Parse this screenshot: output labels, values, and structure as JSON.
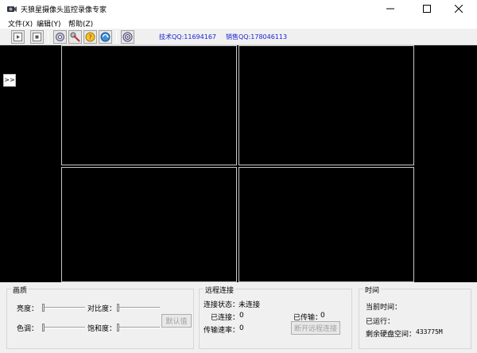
{
  "window": {
    "title": "天狼星摄像头监控录像专家"
  },
  "menu": [
    "文件(X)",
    "编辑(Y)",
    "帮助(Z)"
  ],
  "toolbar": {
    "buttons": [
      "play-icon",
      "stop-icon",
      "settings-icon",
      "search-camera-icon",
      "help-icon",
      "refresh-icon",
      "about-icon"
    ],
    "tech_qq": "技术QQ:11694167",
    "sales_qq": "销售QQ:178046113"
  },
  "video": {
    "expand_label": ">>"
  },
  "image_quality": {
    "title": "画质",
    "brightness_label": "亮度：",
    "contrast_label": "对比度：",
    "hue_label": "色调：",
    "saturation_label": "饱和度：",
    "default_button": "默认值"
  },
  "remote": {
    "title": "远程连接",
    "status_label": "连接状态：",
    "status_value": "未连接",
    "connected_label": "已连接：",
    "connected_value": "0",
    "transferred_label": "已传输：",
    "transferred_value": "0",
    "rate_label": "传输速率：",
    "rate_value": "0",
    "disconnect_button": "断开远程连接"
  },
  "time": {
    "title": "时间",
    "current_label": "当前时间：",
    "running_label": "已运行：",
    "disk_label": "剩余硬盘空间：",
    "disk_value": "433775M"
  }
}
